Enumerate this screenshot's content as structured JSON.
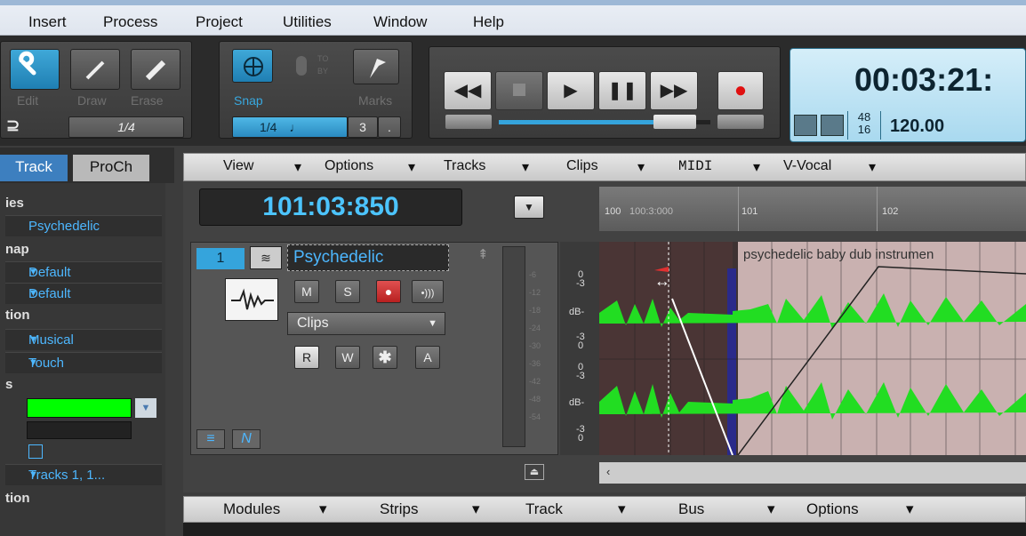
{
  "menu": [
    "Insert",
    "Process",
    "Project",
    "Utilities",
    "Window",
    "Help"
  ],
  "tools": {
    "edit_label": "Edit",
    "draw_label": "Draw",
    "erase_label": "Erase",
    "snap_label": "Snap",
    "to_label": "TO",
    "by_label": "BY",
    "marks_label": "Marks",
    "snap_value": "1/4",
    "snap_grid": "1/4",
    "snap_note": "♩",
    "snap_num": "3",
    "snap_dot": "."
  },
  "transport": {
    "time": "00:03:21:",
    "meter_top": "48",
    "meter_bottom": "16",
    "tempo": "120.00"
  },
  "inspector": {
    "tabs": [
      "Track",
      "ProCh"
    ],
    "sections": [
      "ies",
      "nap",
      "tion",
      "s",
      "tion"
    ],
    "values": [
      "Psychedelic",
      "Default",
      "Default",
      "Musical",
      "Touch",
      "Tracks 1, 1..."
    ],
    "color": "#00ff00"
  },
  "trackview": {
    "menus": [
      "View",
      "Options",
      "Tracks",
      "Clips",
      "MIDI",
      "V-Vocal"
    ],
    "time": "101:03:850",
    "ruler": [
      "100",
      "100:3:000",
      "101",
      "102"
    ]
  },
  "track": {
    "number": "1",
    "name": "Psychedelic",
    "m": "M",
    "s": "S",
    "r": "R",
    "w": "W",
    "a": "A",
    "mode": "Clips",
    "clip_name": "psychedelic baby dub instrumen",
    "db_labels": [
      "0",
      "-3",
      "dB-",
      "-3",
      "0",
      "0",
      "-3",
      "dB-",
      "-3",
      "0"
    ],
    "meter_labels": [
      "-6",
      "-12",
      "-18",
      "-24",
      "-30",
      "-36",
      "-42",
      "-48",
      "-54"
    ]
  },
  "console": {
    "menus": [
      "Modules",
      "Strips",
      "Track",
      "Bus",
      "Options"
    ]
  }
}
